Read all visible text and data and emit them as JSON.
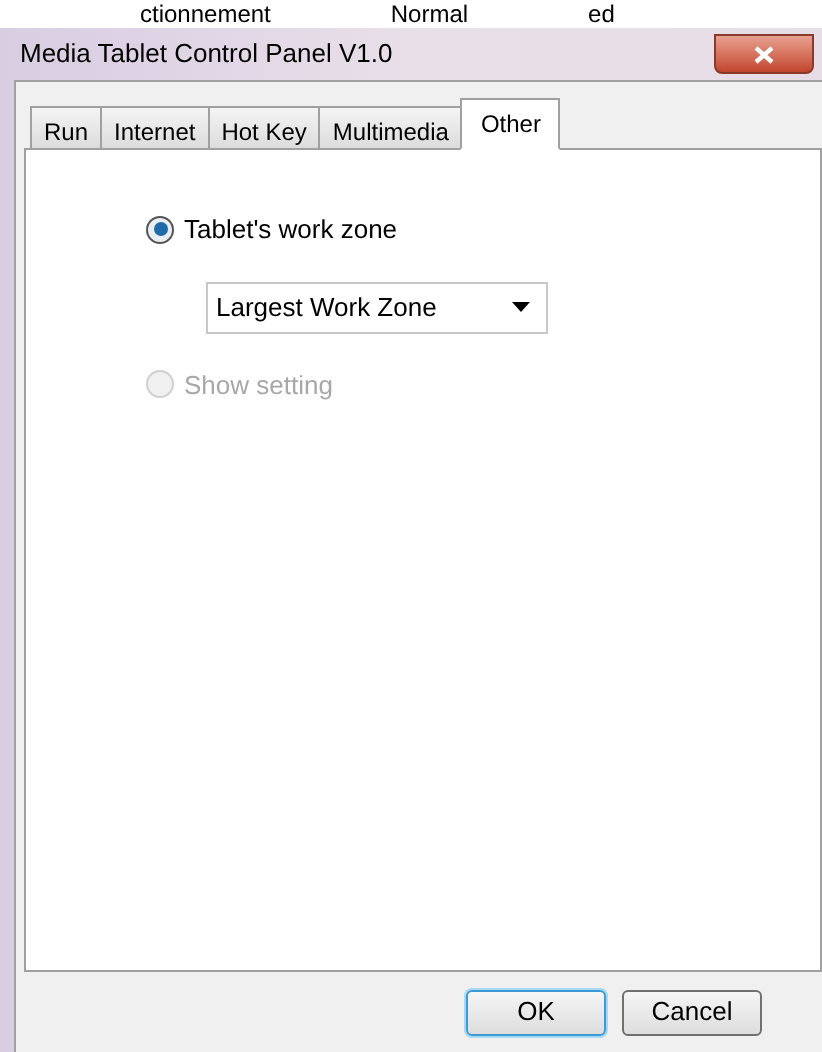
{
  "background_texts": [
    "ctionnement",
    "Normal",
    "ed"
  ],
  "window": {
    "title": "Media Tablet Control Panel V1.0"
  },
  "tabs": [
    {
      "label": "Run",
      "selected": false
    },
    {
      "label": "Internet",
      "selected": false
    },
    {
      "label": "Hot Key",
      "selected": false
    },
    {
      "label": "Multimedia",
      "selected": false
    },
    {
      "label": "Other",
      "selected": true
    }
  ],
  "options": [
    {
      "kind": "radio",
      "label": "Tablet's work zone",
      "selected": true,
      "disabled": false
    },
    {
      "kind": "dropdown",
      "value": "Largest Work Zone",
      "disabled": false
    },
    {
      "kind": "radio",
      "label": "Show setting",
      "selected": false,
      "disabled": true
    }
  ],
  "buttons": [
    {
      "label": "OK",
      "default": true
    },
    {
      "label": "Cancel",
      "default": false
    }
  ]
}
